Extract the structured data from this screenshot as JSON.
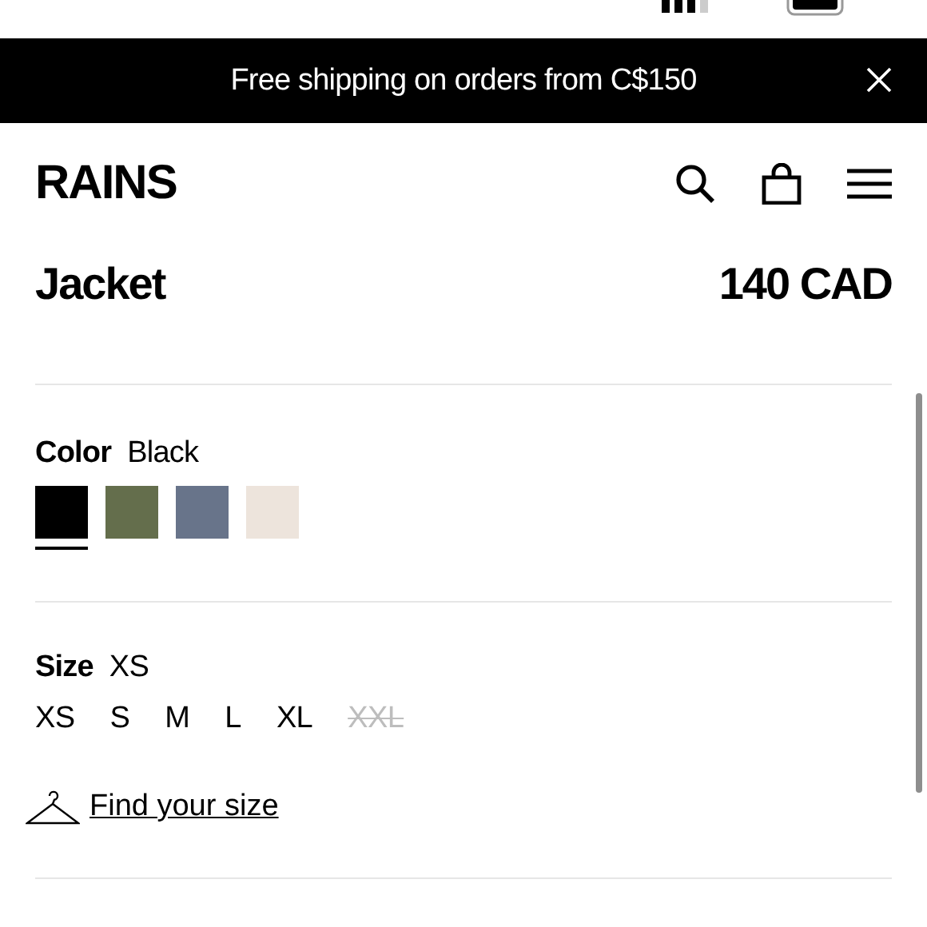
{
  "banner": {
    "text": "Free shipping on orders from C$150"
  },
  "header": {
    "logo": "RAINS"
  },
  "product": {
    "name": "Jacket",
    "price": "140 CAD"
  },
  "color": {
    "label": "Color",
    "value": "Black",
    "swatches": [
      {
        "color": "#000000",
        "selected": true
      },
      {
        "color": "#646e4c",
        "selected": false
      },
      {
        "color": "#68748a",
        "selected": false
      },
      {
        "color": "#ede4dc",
        "selected": false
      }
    ]
  },
  "size": {
    "label": "Size",
    "value": "XS",
    "options": [
      {
        "label": "XS",
        "disabled": false
      },
      {
        "label": "S",
        "disabled": false
      },
      {
        "label": "M",
        "disabled": false
      },
      {
        "label": "L",
        "disabled": false
      },
      {
        "label": "XL",
        "disabled": false
      },
      {
        "label": "XXL",
        "disabled": true
      }
    ]
  },
  "size_guide": {
    "link": "Find your size"
  }
}
